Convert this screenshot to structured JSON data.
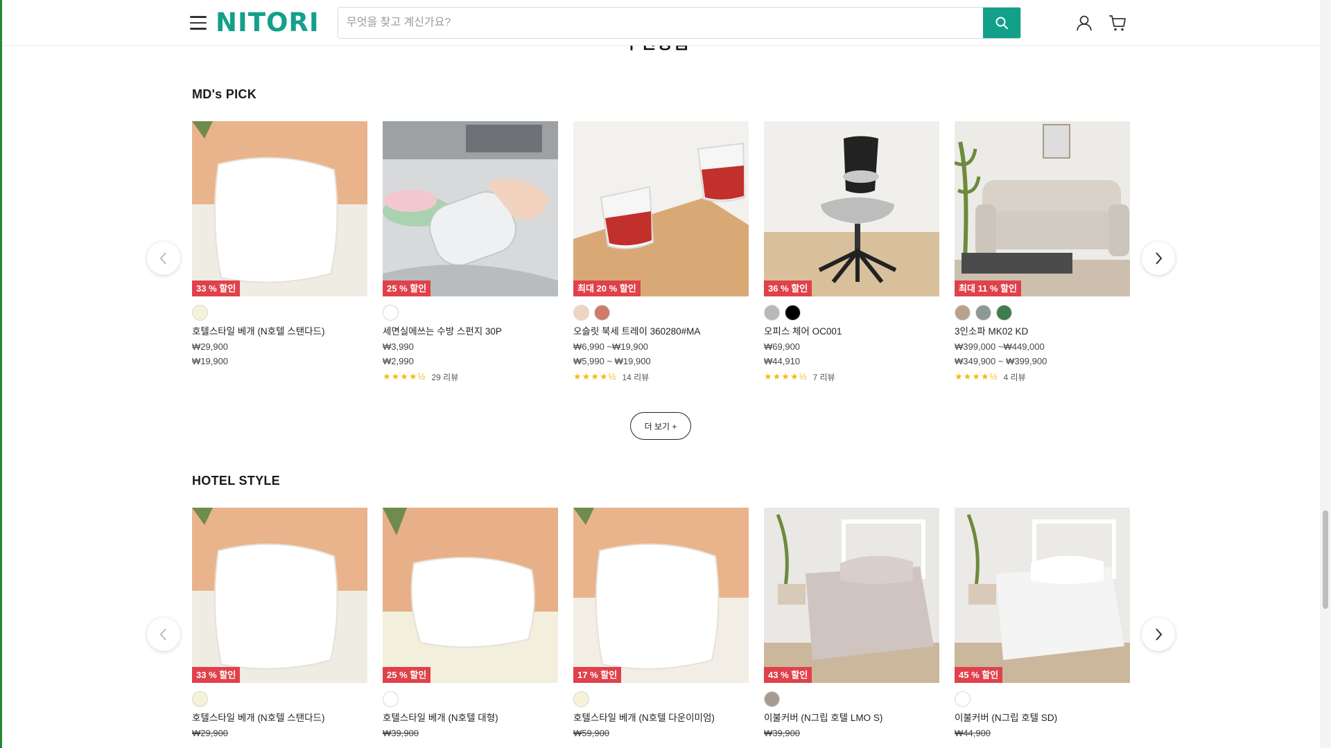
{
  "header": {
    "logo": "NITORI",
    "search_placeholder": "무엇을 찾고 계신가요?"
  },
  "partial_heading": "추천상품",
  "sections": [
    {
      "title": "MD's PICK",
      "more_label": "더 보기 +",
      "products": [
        {
          "badge": "33 % 할인",
          "swatches": [
            "#f6f2d8"
          ],
          "name": "호텔스타일 베개 (N호텔 스탠다드)",
          "price": "₩29,900",
          "sale": "₩19,900",
          "stars": "",
          "rating_count": ""
        },
        {
          "badge": "25 % 할인",
          "swatches": [
            "#ffffff"
          ],
          "name": "세면실에쓰는 수방 스펀지 30P",
          "price": "₩3,990",
          "sale": "₩2,990",
          "stars": "★★★★½",
          "rating_count": "29 리뷰"
        },
        {
          "badge": "최대 20 % 할인",
          "swatches": [
            "#f1d3c2",
            "#cf7b68"
          ],
          "name": "오슬릿 북세 트레이 360280#MA",
          "price": "₩6,990 ~₩19,900",
          "sale": "₩5,990 ~ ₩19,900",
          "stars": "★★★★½",
          "rating_count": "14 리뷰"
        },
        {
          "badge": "36 % 할인",
          "swatches": [
            "#b8b8b8",
            "#000000"
          ],
          "name": "오피스 체어 OC001",
          "price": "₩69,900",
          "sale": "₩44,910",
          "stars": "★★★★½",
          "rating_count": "7 리뷰"
        },
        {
          "badge": "최대 11 % 할인",
          "swatches": [
            "#b8a28e",
            "#8c9995",
            "#3e7d4e"
          ],
          "name": "3인소파 MK02 KD",
          "price": "₩399,000 ~₩449,000",
          "sale": "₩349,900 ~ ₩399,900",
          "stars": "★★★★½",
          "rating_count": "4 리뷰"
        }
      ]
    },
    {
      "title": "HOTEL STYLE",
      "products": [
        {
          "badge": "33 % 할인",
          "swatches": [
            "#f6f2d8"
          ],
          "name": "호텔스타일 베개 (N호텔 스탠다드)",
          "price": "₩29,900"
        },
        {
          "badge": "25 % 할인",
          "swatches": [
            "#ffffff"
          ],
          "name": "호텔스타일 베개 (N호텔 대형)",
          "price": "₩39,900"
        },
        {
          "badge": "17 % 할인",
          "swatches": [
            "#f6f2d8"
          ],
          "name": "호텔스타일 베개 (N호텔 다운이미엄)",
          "price": "₩59,900"
        },
        {
          "badge": "43 % 할인",
          "swatches": [
            "#a89c90"
          ],
          "name": "이불커버 (N그립 호텔 LMO S)",
          "price": "₩39,900"
        },
        {
          "badge": "45 % 할인",
          "swatches": [
            "#ffffff"
          ],
          "name": "이불커버 (N그립 호텔 SD)",
          "price": "₩44,900"
        }
      ]
    }
  ],
  "colors": {
    "brand": "#13a089",
    "badge": "#e0414a",
    "star": "#f5b81c"
  },
  "icons": [
    "menu-icon",
    "search-icon",
    "user-icon",
    "cart-icon",
    "chevron-left-icon",
    "chevron-right-icon"
  ]
}
